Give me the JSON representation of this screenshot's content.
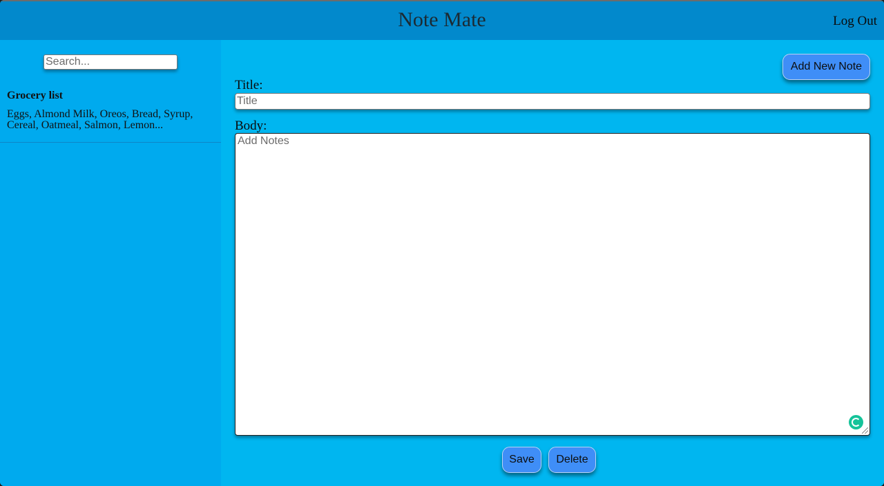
{
  "header": {
    "app_title": "Note Mate",
    "logout_label": "Log Out"
  },
  "sidebar": {
    "search": {
      "value": "",
      "placeholder": "Search..."
    },
    "notes": [
      {
        "title": "Grocery list",
        "preview": "Eggs, Almond Milk, Oreos, Bread, Syrup, Cereal, Oatmeal, Salmon, Lemon..."
      }
    ]
  },
  "editor": {
    "add_button_label": "Add New Note",
    "title_label": "Title:",
    "title_input": {
      "value": "",
      "placeholder": "Title"
    },
    "body_label": "Body:",
    "body_input": {
      "value": "",
      "placeholder": "Add Notes"
    },
    "save_label": "Save",
    "delete_label": "Delete",
    "grammarly_icon": "grammarly-icon"
  },
  "colors": {
    "header_bg": "#0289cc",
    "sidebar_bg": "#00aaee",
    "main_bg": "#00b6f0",
    "button_bg": "#3f8ef7"
  }
}
